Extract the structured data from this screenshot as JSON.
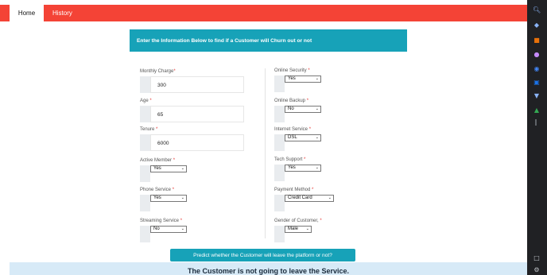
{
  "nav": {
    "home": "Home",
    "history": "History"
  },
  "banner": {
    "title": "Enter the Information Below to find if a Customer will Churn out or not"
  },
  "form": {
    "left": [
      {
        "label": "Monthly Charge",
        "type": "number",
        "value": "300"
      },
      {
        "label": "Age ",
        "type": "number",
        "value": "65"
      },
      {
        "label": "Tenure ",
        "type": "number",
        "value": "6000"
      },
      {
        "label": "Active Member ",
        "type": "select",
        "value": "Yes"
      },
      {
        "label": "Phone Service ",
        "type": "select",
        "value": "Yes"
      },
      {
        "label": "Streaming Service ",
        "type": "select",
        "value": "No"
      }
    ],
    "right": [
      {
        "label": "Online Security ",
        "type": "select",
        "value": "Yes"
      },
      {
        "label": "Online Backup ",
        "type": "select",
        "value": "No"
      },
      {
        "label": "Internet Service ",
        "type": "select",
        "value": "DSL"
      },
      {
        "label": "Tech Support ",
        "type": "select",
        "value": "Yes"
      },
      {
        "label": "Payment Method ",
        "type": "select",
        "value": "Credit Card"
      },
      {
        "label": "Gender of Customer, ",
        "type": "select",
        "value": "Male"
      }
    ],
    "required_mark": "*"
  },
  "predict_button": "Predict whether the Customer will leave the platform or not?",
  "result": "The Customer is not going to leave the Service.",
  "sidebar_icons": [
    "search-icon",
    "tag-icon",
    "briefcase-icon",
    "people-icon",
    "copilot-icon",
    "outlook-icon",
    "shopping-icon",
    "tree-icon",
    "add-icon",
    "panel-icon",
    "settings-icon"
  ],
  "colors": {
    "nav": "#f44336",
    "accent": "#17a2b8",
    "result_bg": "#d7eaf7",
    "required": "#e53935"
  }
}
